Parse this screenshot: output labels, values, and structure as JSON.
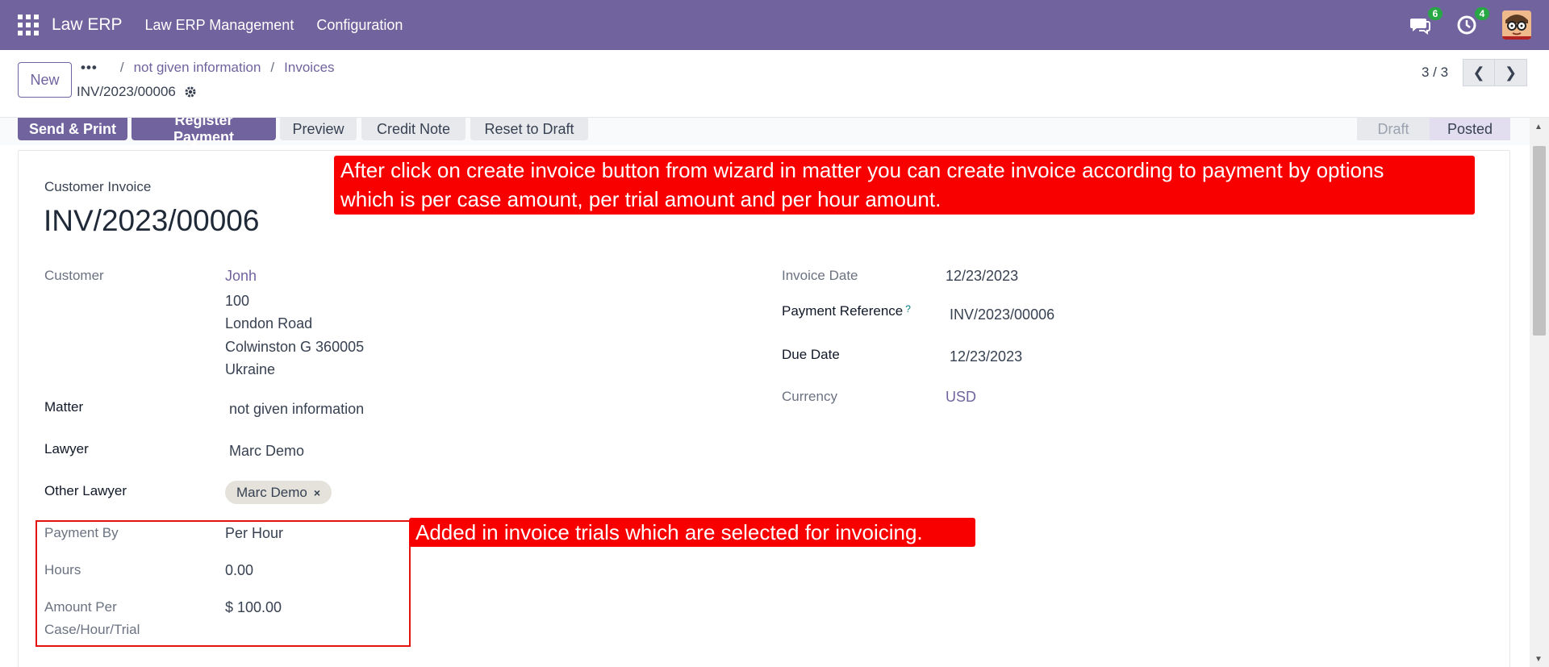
{
  "navbar": {
    "brand": "Law ERP",
    "menus": [
      "Law ERP Management",
      "Configuration"
    ],
    "messages_count": "6",
    "activities_count": "4"
  },
  "control": {
    "new_label": "New",
    "breadcrumb": [
      "not given information",
      "Invoices"
    ],
    "record_name": "INV/2023/00006",
    "pager": "3 / 3"
  },
  "actions": {
    "send_print": "Send & Print",
    "register_payment": "Register Payment",
    "preview": "Preview",
    "credit_note": "Credit Note",
    "reset_to_draft": "Reset to Draft"
  },
  "stages": {
    "draft": "Draft",
    "posted": "Posted",
    "current": "Posted"
  },
  "invoice": {
    "type": "Customer Invoice",
    "name": "INV/2023/00006",
    "customer_label": "Customer",
    "customer": "Jonh",
    "address": [
      "100",
      "London Road",
      "Colwinston G 360005",
      "Ukraine"
    ],
    "matter_label": "Matter",
    "matter": "not given information",
    "lawyer_label": "Lawyer",
    "lawyer": "Marc Demo",
    "other_lawyer_label": "Other Lawyer",
    "other_lawyer_tag": "Marc Demo",
    "payment_by_label": "Payment By",
    "payment_by": "Per Hour",
    "hours_label": "Hours",
    "hours": "0.00",
    "amount_label_1": "Amount Per",
    "amount_label_2": "Case/Hour/Trial",
    "amount": "$ 100.00",
    "invoice_date_label": "Invoice Date",
    "invoice_date": "12/23/2023",
    "payment_ref_label": "Payment Reference",
    "payment_ref": "INV/2023/00006",
    "due_date_label": "Due Date",
    "due_date": "12/23/2023",
    "currency_label": "Currency",
    "currency": "USD"
  },
  "annotations": {
    "top_line1": "After click on create invoice button from wizard in matter you can create invoice according to payment by options",
    "top_line2": "which is per case amount, per trial amount and per hour amount.",
    "bottom": "Added in invoice trials which are selected for invoicing."
  },
  "colors": {
    "brand": "#71639e",
    "annotation": "#f80000"
  }
}
